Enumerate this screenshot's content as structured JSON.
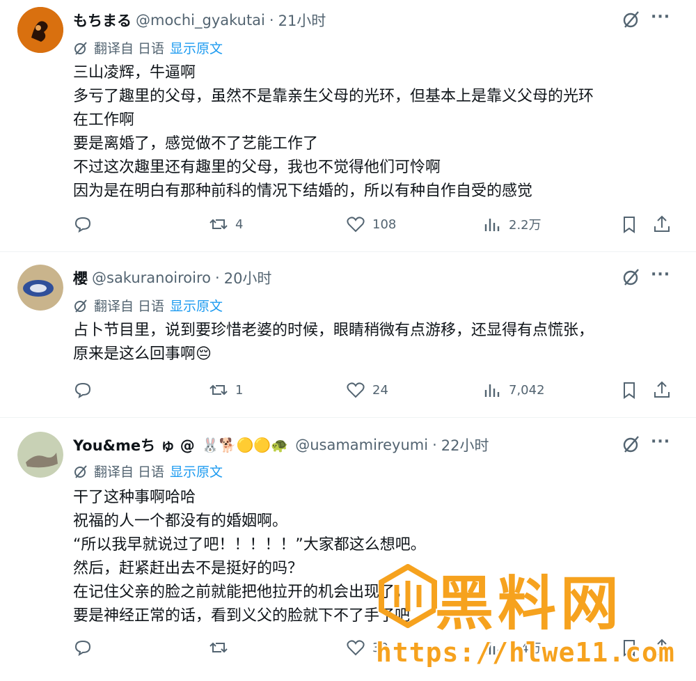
{
  "posts": [
    {
      "author": "もちまる",
      "handle": "@mochi_gyakutai",
      "dot": "·",
      "time": "21小时",
      "translate_from": "翻译自 日语",
      "show_original": "显示原文",
      "lines": [
        "三山凌辉，牛逼啊",
        "多亏了趣里的父母，虽然不是靠亲生父母的光环，但基本上是靠义父母的光环",
        "在工作啊",
        "要是离婚了，感觉做不了艺能工作了",
        "不过这次趣里还有趣里的父母，我也不觉得他们可怜啊",
        "因为是在明白有那种前科的情况下结婚的，所以有种自作自受的感觉"
      ],
      "reply_count": "",
      "retweet_count": "4",
      "like_count": "108",
      "view_count": "2.2万"
    },
    {
      "author": "櫻",
      "handle": "@sakuranoiroiro",
      "dot": "·",
      "time": "20小时",
      "translate_from": "翻译自 日语",
      "show_original": "显示原文",
      "lines": [
        "占卜节目里，说到要珍惜老婆的时候，眼睛稍微有点游移，还显得有点慌张，",
        "原来是这么回事啊😔"
      ],
      "reply_count": "",
      "retweet_count": "1",
      "like_count": "24",
      "view_count": "7,042"
    },
    {
      "author": "You&meち ゅ @",
      "author_emojis": "🐰🐕🟡🟡🐢",
      "handle": "@usamamireyumi",
      "dot": "·",
      "time": "22小时",
      "translate_from": "翻译自 日语",
      "show_original": "显示原文",
      "lines": [
        "干了这种事啊哈哈",
        "祝福的人一个都没有的婚姻啊。",
        "“所以我早就说过了吧！！！！！”大家都这么想吧。",
        "然后，赶紧赶出去不是挺好的吗？",
        "在记住父亲的脸之前就能把他拉开的机会出现了，",
        "要是神经正常的话，看到义父的脸就下不了手了吧"
      ],
      "reply_count": "",
      "retweet_count": "",
      "like_count": "30",
      "view_count": "2.4万"
    }
  ],
  "more_label": "···",
  "watermark": {
    "title": "黑料网",
    "url": "https://hlwe11.com"
  },
  "colors": {
    "accent": "#1d9bf0",
    "muted": "#536471",
    "watermark": "#f6a21e"
  }
}
